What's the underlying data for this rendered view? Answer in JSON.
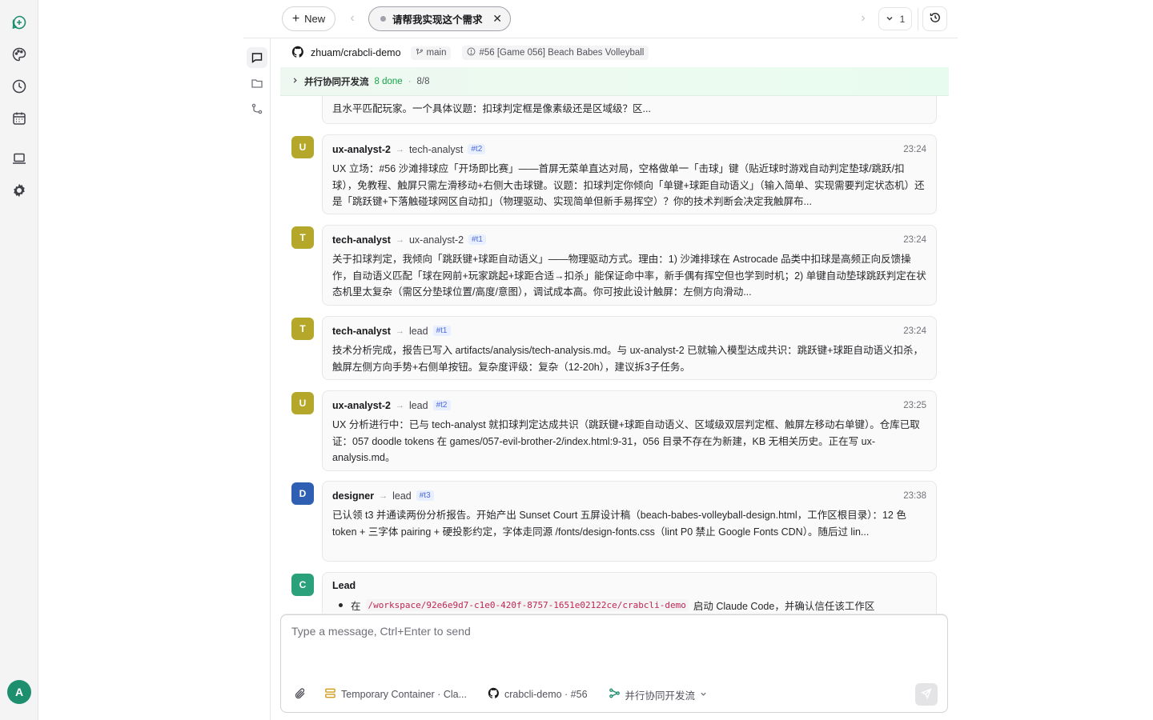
{
  "topbar": {
    "new_label": "New",
    "tab_title": "请帮我实现这个需求",
    "count": "1"
  },
  "repo": {
    "name": "zhuam/crabcli-demo",
    "branch": "main",
    "issue": "#56 [Game 056] Beach Babes Volleyball"
  },
  "banner": {
    "title": "并行协同开发流",
    "done": "8 done",
    "separator": "·",
    "progress": "8/8"
  },
  "messages": {
    "partial": {
      "text": "且水平匹配玩家。一个具体议题：扣球判定框是像素级还是区域级？区..."
    },
    "items": [
      {
        "avatar": "U",
        "avatar_color": "#b5a72a",
        "from": "ux-analyst-2",
        "to": "tech-analyst",
        "tag": "#t2",
        "time": "23:24",
        "body": "UX 立场：#56 沙滩排球应「开场即比赛」——首屏无菜单直达对局，空格做单一「击球」键（贴近球时游戏自动判定垫球/跳跃/扣球），免教程、触屏只需左滑移动+右侧大击球键。议题：扣球判定你倾向「单键+球距自动语义」（输入简单、实现需要判定状态机）还是「跳跃键+下落触碰球网区自动扣」（物理驱动、实现简单但新手易挥空）？你的技术判断会决定我触屏布..."
      },
      {
        "avatar": "T",
        "avatar_color": "#b5a72a",
        "from": "tech-analyst",
        "to": "ux-analyst-2",
        "tag": "#t1",
        "time": "23:24",
        "body": "关于扣球判定，我倾向「跳跃键+球距自动语义」——物理驱动方式。理由：1) 沙滩排球在 Astrocade 品类中扣球是高频正向反馈操作，自动语义匹配「球在网前+玩家跳起+球距合适→扣杀」能保证命中率，新手偶有挥空但也学到时机；2) 单键自动垫球跳跃判定在状态机里太复杂（需区分垫球位置/高度/意图），调试成本高。你可按此设计触屏：左侧方向滑动..."
      },
      {
        "avatar": "T",
        "avatar_color": "#b5a72a",
        "from": "tech-analyst",
        "to": "lead",
        "tag": "#t1",
        "time": "23:24",
        "body": "技术分析完成，报告已写入 artifacts/analysis/tech-analysis.md。与 ux-analyst-2 已就输入模型达成共识：跳跃键+球距自动语义扣杀，触屏左侧方向手势+右侧单按钮。复杂度评级：复杂（12-20h），建议拆3子任务。"
      },
      {
        "avatar": "U",
        "avatar_color": "#b5a72a",
        "from": "ux-analyst-2",
        "to": "lead",
        "tag": "#t2",
        "time": "23:25",
        "body": "UX 分析进行中：已与 tech-analyst 就扣球判定达成共识（跳跃键+球距自动语义、区域级双层判定框、触屏左移动右单键）。仓库已取证：057 doodle tokens 在 games/057-evil-brother-2/index.html:9-31，056 目录不存在为新建，KB 无相关历史。正在写 ux-analysis.md。"
      },
      {
        "avatar": "D",
        "avatar_color": "#2f5fb3",
        "from": "designer",
        "to": "lead",
        "tag": "#t3",
        "time": "23:38",
        "body": "已认领 t3 并通读两份分析报告。开始产出 Sunset Court 五屏设计稿（beach-babes-volleyball-design.html，工作区根目录）：12 色 token + 三字体 pairing + 硬投影约定，字体走同源 /fonts/design-fonts.css（lint P0 禁止 Google Fonts CDN）。随后过 lin..."
      }
    ],
    "lead": {
      "avatar": "C",
      "avatar_color": "#2aa17a",
      "name": "Lead",
      "prefix": "在",
      "path": "/workspace/92e6e9d7-c1e0-420f-8757-1651e02122ce/crabcli-demo",
      "suffix": "启动 Claude Code，并确认信任该工作区"
    }
  },
  "composer": {
    "placeholder": "Type a message, Ctrl+Enter to send",
    "container": "Temporary Container · Cla...",
    "repo": "crabcli-demo · #56",
    "workflow": "并行协同开发流"
  },
  "rail": {
    "avatar": "A",
    "accent": "#1e8f6e"
  }
}
